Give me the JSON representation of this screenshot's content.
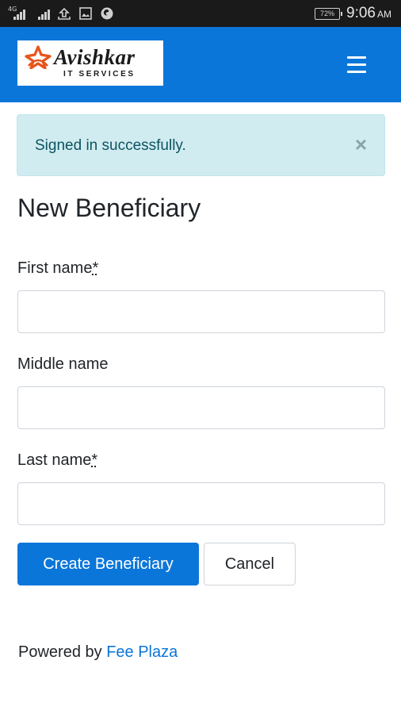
{
  "status_bar": {
    "network": "4G",
    "battery": "72%",
    "time": "9:06",
    "ampm": "AM"
  },
  "header": {
    "logo": {
      "name": "Avishkar",
      "subtitle": "IT SERVICES"
    },
    "menu_icon": "hamburger-icon"
  },
  "alert": {
    "message": "Signed in successfully.",
    "close": "×"
  },
  "form": {
    "title": "New Beneficiary",
    "fields": [
      {
        "label": "First name",
        "required_mark": "*",
        "value": ""
      },
      {
        "label": "Middle name",
        "required_mark": "",
        "value": ""
      },
      {
        "label": "Last name",
        "required_mark": "*",
        "value": ""
      }
    ],
    "submit_label": "Create Beneficiary",
    "cancel_label": "Cancel"
  },
  "footer": {
    "prefix": "Powered by",
    "link_text": "Fee Plaza"
  },
  "colors": {
    "primary": "#0b76d9",
    "alert_bg": "#d1ecf1",
    "alert_text": "#0c5460",
    "status_bar": "#1a1a1a"
  }
}
